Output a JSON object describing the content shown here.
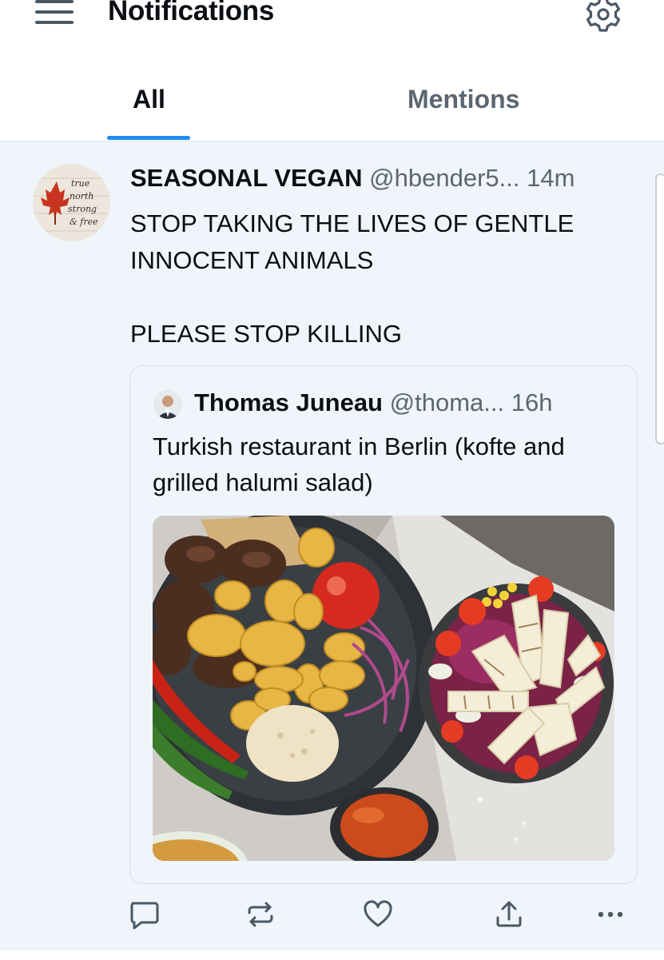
{
  "header": {
    "title": "Notifications",
    "menu_icon": "hamburger-menu-icon",
    "settings_icon": "gear-icon"
  },
  "tabs": [
    {
      "label": "All",
      "selected": true
    },
    {
      "label": "Mentions",
      "selected": false
    }
  ],
  "colors": {
    "accent": "#1d8cf0",
    "row_background": "#f0f5fb",
    "muted_text": "#5b6670"
  },
  "notification": {
    "author_name": "SEASONAL VEGAN",
    "author_handle": "@hbender5...",
    "time": "14m",
    "avatar_text": [
      "true",
      "north",
      "strong",
      "& free"
    ],
    "text_line1": "STOP TAKING THE LIVES OF GENTLE INNOCENT ANIMALS",
    "text_line2": "PLEASE STOP KILLING",
    "quote": {
      "author_name": "Thomas Juneau",
      "author_handle": "@thoma...",
      "time": "16h",
      "text": "Turkish restaurant in Berlin (kofte and grilled halumi salad)",
      "image": "food-photo"
    },
    "actions": [
      "reply-icon",
      "repost-icon",
      "like-icon",
      "share-icon",
      "more-icon"
    ]
  }
}
